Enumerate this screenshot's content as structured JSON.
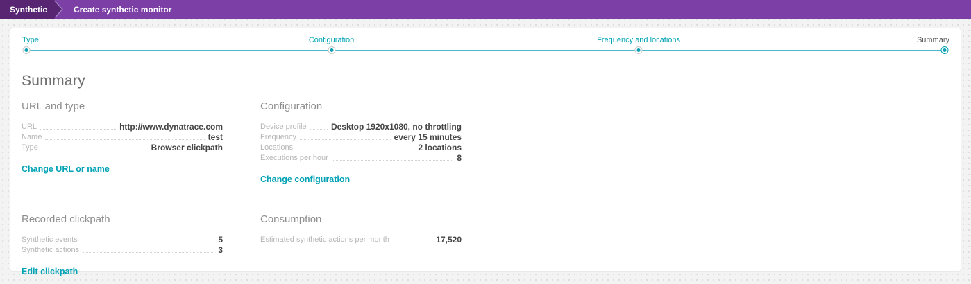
{
  "header": {
    "breadcrumb": "Synthetic",
    "title": "Create synthetic monitor"
  },
  "stepper": {
    "steps": [
      {
        "label": "Type",
        "state": "done"
      },
      {
        "label": "Configuration",
        "state": "done"
      },
      {
        "label": "Frequency and locations",
        "state": "done"
      },
      {
        "label": "Summary",
        "state": "active"
      }
    ]
  },
  "page_title": "Summary",
  "sections": {
    "url_and_type": {
      "title": "URL and type",
      "rows": [
        {
          "label": "URL",
          "value": "http://www.dynatrace.com"
        },
        {
          "label": "Name",
          "value": "test"
        },
        {
          "label": "Type",
          "value": "Browser clickpath"
        }
      ],
      "link": "Change URL or name"
    },
    "configuration": {
      "title": "Configuration",
      "rows": [
        {
          "label": "Device profile",
          "value": "Desktop 1920x1080, no throttling"
        },
        {
          "label": "Frequency",
          "value": "every 15 minutes"
        },
        {
          "label": "Locations",
          "value": "2 locations"
        },
        {
          "label": "Executions per hour",
          "value": "8"
        }
      ],
      "link": "Change configuration"
    },
    "recorded_clickpath": {
      "title": "Recorded clickpath",
      "rows": [
        {
          "label": "Synthetic events",
          "value": "5"
        },
        {
          "label": "Synthetic actions",
          "value": "3"
        }
      ],
      "link": "Edit clickpath"
    },
    "consumption": {
      "title": "Consumption",
      "rows": [
        {
          "label": "Estimated synthetic actions per month",
          "value": "17,520"
        }
      ]
    }
  },
  "colors": {
    "header_purple": "#7b3fa5",
    "header_dark_purple": "#582573",
    "accent_teal": "#00a2b4",
    "value_text": "#454545",
    "label_text": "#b6b6b6"
  }
}
